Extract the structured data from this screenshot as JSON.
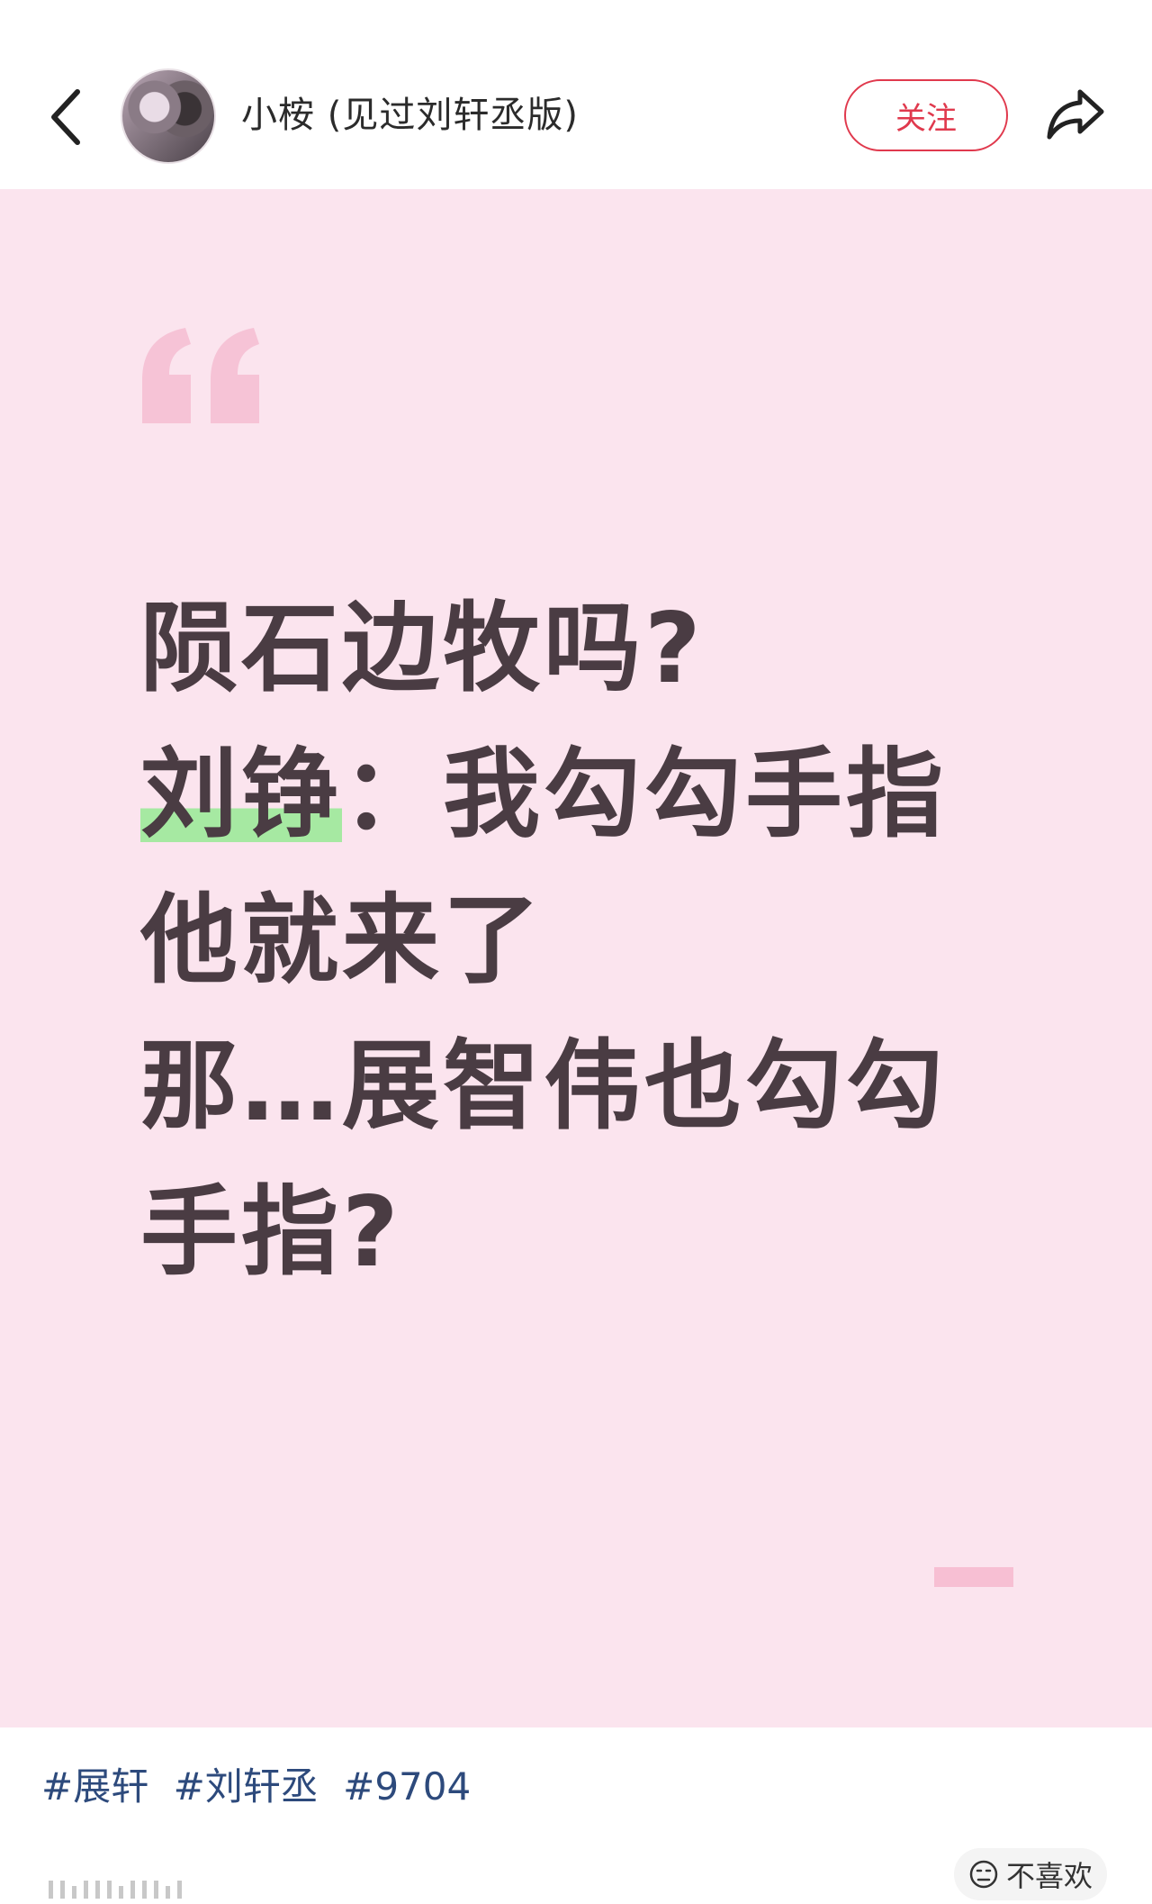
{
  "header": {
    "username": "小桉 (见过刘轩丞版)",
    "follow_label": "关注"
  },
  "post": {
    "lines": [
      [
        "陨石边牧吗?"
      ],
      [
        "刘铮",
        "：我勾勾手指"
      ],
      [
        "他就来了"
      ],
      [
        "那…展智伟也勾勾"
      ],
      [
        "手指?"
      ]
    ],
    "highlight_color": "#a6e9a2",
    "background_color": "#fbe4ee"
  },
  "tags": [
    "#展轩",
    "#刘轩丞",
    "#9704"
  ],
  "footer": {
    "dislike_label": "不喜欢"
  },
  "colors": {
    "accent": "#e0394d",
    "tag": "#2d4a7c",
    "text": "#4a3c43"
  }
}
